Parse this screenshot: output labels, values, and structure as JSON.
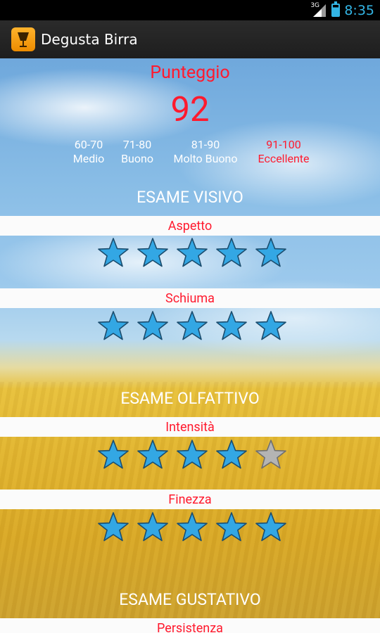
{
  "status_bar": {
    "network": "3G",
    "time": "8:35",
    "icons": [
      "signal-icon",
      "battery-icon"
    ]
  },
  "app": {
    "title": "Degusta Birra",
    "icon": "beer-glass-icon"
  },
  "score": {
    "title": "Punteggio",
    "value": "92",
    "ranges": [
      {
        "range": "60-70",
        "label": "Medio"
      },
      {
        "range": "71-80",
        "label": "Buono"
      },
      {
        "range": "81-90",
        "label": "Molto Buono"
      },
      {
        "range": "91-100",
        "label": "Eccellente",
        "highlighted": true
      }
    ]
  },
  "sections": {
    "visivo": "ESAME VISIVO",
    "olfattivo": "ESAME OLFATTIVO",
    "gustativo": "ESAME GUSTATIVO"
  },
  "criteria": [
    {
      "label": "Aspetto",
      "rating": 5,
      "max": 5
    },
    {
      "label": "Schiuma",
      "rating": 5,
      "max": 5
    },
    {
      "label": "Intensità",
      "rating": 4,
      "max": 5
    },
    {
      "label": "Finezza",
      "rating": 5,
      "max": 5
    },
    {
      "label": "Persistenza"
    }
  ],
  "colors": {
    "accent_red": "#ff1a2e",
    "star_filled": "#33a7e4",
    "star_empty": "#b4b4b4",
    "statusbar_accent": "#33b5e5"
  }
}
